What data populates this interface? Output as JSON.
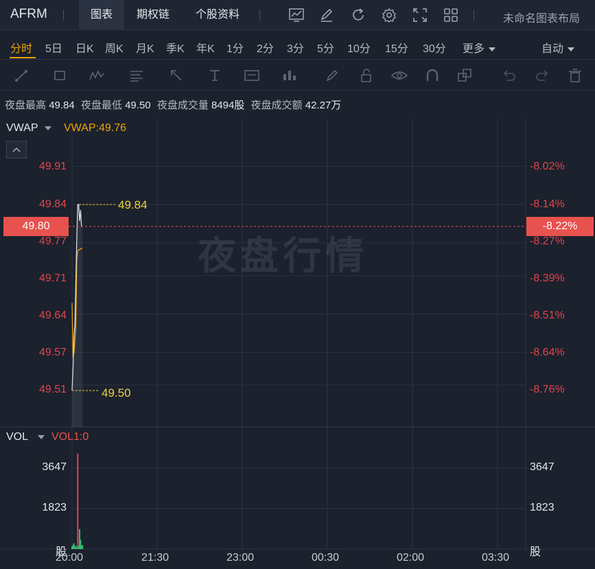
{
  "header": {
    "symbol": "AFRM",
    "tabs": [
      {
        "label": "图表",
        "active": true
      },
      {
        "label": "期权链",
        "active": false
      },
      {
        "label": "个股资料",
        "active": false
      }
    ],
    "icons": [
      "indicator-chart-icon",
      "pen-icon",
      "refresh-icon",
      "settings-icon",
      "fullscreen-icon",
      "grid-layout-icon"
    ],
    "layout_name": "未命名图表布局"
  },
  "periods": {
    "items": [
      "分时",
      "5日",
      "日K",
      "周K",
      "月K",
      "季K",
      "年K",
      "1分",
      "2分",
      "3分",
      "5分",
      "10分",
      "15分",
      "30分"
    ],
    "active": "分时",
    "more_label": "更多",
    "auto_label": "自动"
  },
  "tools": [
    "trend-line-icon",
    "rectangle-icon",
    "pattern-icon",
    "fib-icon",
    "arrow-icon",
    "text-icon",
    "note-icon",
    "measure-icon",
    "brush-icon",
    "lock-icon",
    "eye-icon",
    "magnet-icon",
    "layers-icon",
    "undo-icon",
    "redo-icon",
    "trash-icon"
  ],
  "stats": {
    "high_label": "夜盘最高",
    "high": "49.84",
    "low_label": "夜盘最低",
    "low": "49.50",
    "volume_label": "夜盘成交量",
    "volume": "8494股",
    "turnover_label": "夜盘成交额",
    "turnover": "42.27万"
  },
  "main_panel": {
    "indicator": "VWAP",
    "indicator_value": "VWAP:49.76",
    "y_labels": [
      "49.91",
      "49.84",
      "49.77",
      "49.71",
      "49.64",
      "49.57",
      "49.51"
    ],
    "pct_labels": [
      "-8.02%",
      "-8.14%",
      "-8.27%",
      "-8.39%",
      "-8.51%",
      "-8.64%",
      "-8.76%"
    ],
    "current_price": "49.80",
    "current_pct": "-8.22%",
    "high_marker": "49.84",
    "low_marker": "49.50",
    "watermark": "夜盘行情"
  },
  "volume_panel": {
    "indicator": "VOL",
    "indicator_value": "VOL1:0",
    "y_labels": [
      "3647",
      "1823"
    ],
    "unit": "股"
  },
  "time_axis": [
    "20:00",
    "21:30",
    "23:00",
    "00:30",
    "02:00",
    "03:30"
  ],
  "colors": {
    "background": "#1b212d",
    "accent": "#f0a400",
    "down": "#e2454a",
    "up": "#2fbf71",
    "price_line": "#d8dbe0",
    "vwap_line": "#f0a400",
    "marker": "#f2d33a"
  },
  "chart_data": {
    "type": "line",
    "x_axis": [
      "20:00",
      "21:30",
      "23:00",
      "00:30",
      "02:00",
      "03:30"
    ],
    "y_range": [
      49.48,
      49.94
    ],
    "price": [
      [
        "20:00",
        49.5
      ],
      [
        "20:01",
        49.54
      ],
      [
        "20:02",
        49.6
      ],
      [
        "20:03",
        49.62
      ],
      [
        "20:04",
        49.7
      ],
      [
        "20:05",
        49.78
      ],
      [
        "20:06",
        49.84
      ],
      [
        "20:07",
        49.84
      ],
      [
        "20:08",
        49.81
      ],
      [
        "20:09",
        49.83
      ],
      [
        "20:10",
        49.8
      ],
      [
        "20:11",
        49.8
      ]
    ],
    "vwap": [
      [
        "20:00",
        49.66
      ],
      [
        "20:01",
        49.56
      ],
      [
        "20:02",
        49.57
      ],
      [
        "20:03",
        49.59
      ],
      [
        "20:04",
        49.62
      ],
      [
        "20:05",
        49.74
      ],
      [
        "20:06",
        49.755
      ],
      [
        "20:07",
        49.757
      ],
      [
        "20:08",
        49.758
      ],
      [
        "20:09",
        49.759
      ],
      [
        "20:10",
        49.76
      ],
      [
        "20:11",
        49.76
      ]
    ],
    "volume_range": [
      0,
      4400
    ],
    "volume": [
      [
        "20:00",
        120,
        "up"
      ],
      [
        "20:01",
        180,
        "up"
      ],
      [
        "20:02",
        260,
        "up"
      ],
      [
        "20:03",
        90,
        "up"
      ],
      [
        "20:04",
        150,
        "up"
      ],
      [
        "20:05",
        80,
        "up"
      ],
      [
        "20:06",
        4300,
        "down"
      ],
      [
        "20:07",
        140,
        "up"
      ],
      [
        "20:08",
        900,
        "up"
      ],
      [
        "20:09",
        420,
        "up"
      ],
      [
        "20:10",
        160,
        "up"
      ],
      [
        "20:11",
        180,
        "up"
      ]
    ]
  }
}
